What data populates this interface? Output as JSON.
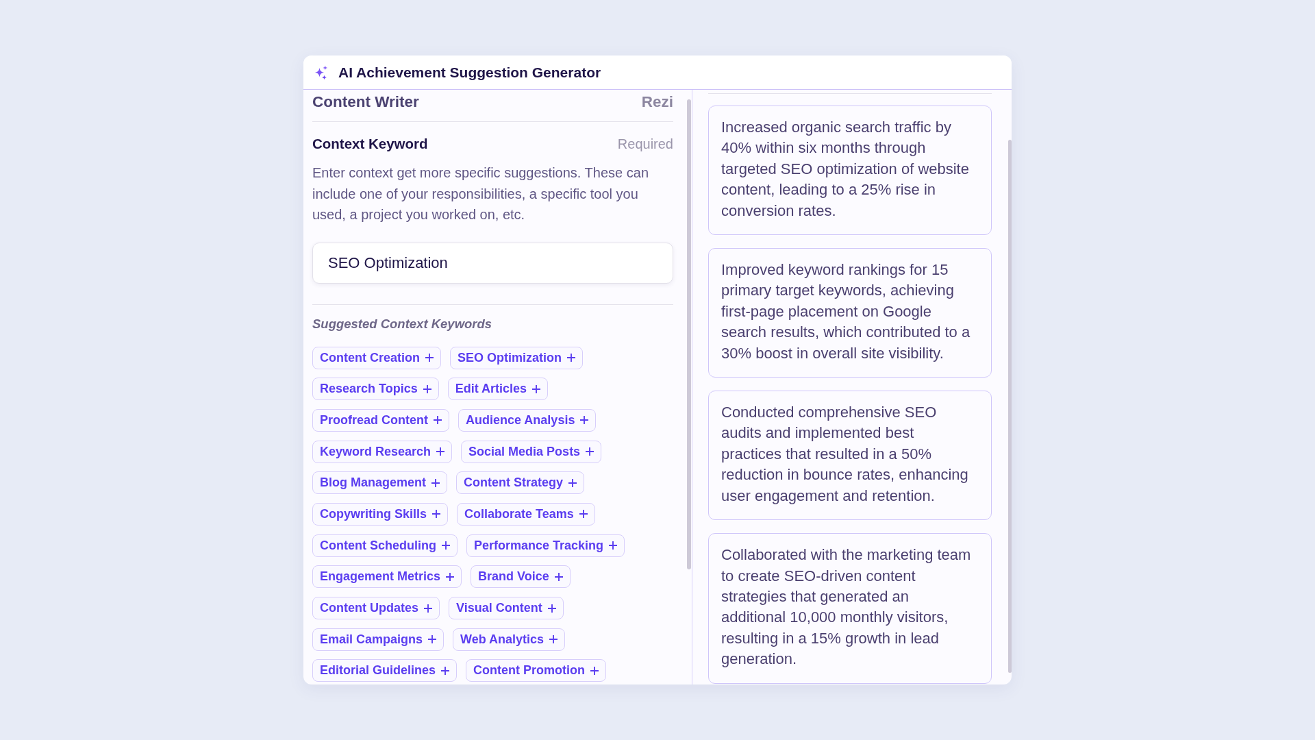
{
  "window": {
    "title": "AI Achievement Suggestion Generator"
  },
  "job": {
    "title": "Content Writer",
    "right_label": "Rezi"
  },
  "context_keyword": {
    "label": "Context Keyword",
    "tag": "Required",
    "description": "Enter context get more specific suggestions. These can include one of your responsibilities, a specific tool you used, a project you worked on, etc.",
    "value": "SEO Optimization"
  },
  "suggested_keywords": {
    "heading": "Suggested Context Keywords",
    "items": [
      "Content Creation",
      "SEO Optimization",
      "Research Topics",
      "Edit Articles",
      "Proofread Content",
      "Audience Analysis",
      "Keyword Research",
      "Social Media Posts",
      "Blog Management",
      "Content Strategy",
      "Copywriting Skills",
      "Collaborate Teams",
      "Content Scheduling",
      "Performance Tracking",
      "Engagement Metrics",
      "Brand Voice",
      "Content Updates",
      "Visual Content",
      "Email Campaigns",
      "Web Analytics",
      "Editorial Guidelines",
      "Content Promotion"
    ]
  },
  "suggestions": [
    "Increased organic search traffic by 40% within six months through targeted SEO optimization of website content, leading to a 25% rise in conversion rates.",
    "Improved keyword rankings for 15 primary target keywords, achieving first-page placement on Google search results, which contributed to a 30% boost in overall site visibility.",
    "Conducted comprehensive SEO audits and implemented best practices that resulted in a 50% reduction in bounce rates, enhancing user engagement and retention.",
    "Collaborated with the marketing team to create SEO-driven content strategies that generated an additional 10,000 monthly visitors, resulting in a 15% growth in lead generation."
  ]
}
